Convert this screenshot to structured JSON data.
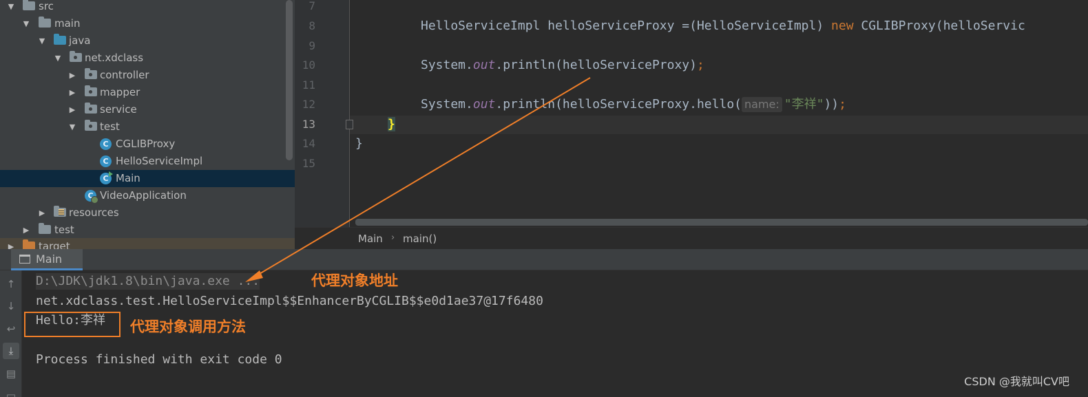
{
  "project_tree": {
    "items": [
      {
        "label": "src",
        "expanded": true
      },
      {
        "label": "main",
        "expanded": true
      },
      {
        "label": "java",
        "expanded": true
      },
      {
        "label": "net.xdclass",
        "expanded": true
      },
      {
        "label": "controller",
        "expanded": false
      },
      {
        "label": "mapper",
        "expanded": false
      },
      {
        "label": "service",
        "expanded": false
      },
      {
        "label": "test",
        "expanded": true
      },
      {
        "label": "CGLIBProxy",
        "icon_letter": "C"
      },
      {
        "label": "HelloServiceImpl",
        "icon_letter": "C"
      },
      {
        "label": "Main",
        "icon_letter": "C",
        "selected": true
      },
      {
        "label": "VideoApplication",
        "icon_letter": "C"
      },
      {
        "label": "resources",
        "expanded": false
      },
      {
        "label": "test",
        "expanded": false
      },
      {
        "label": "target",
        "expanded": false
      }
    ]
  },
  "editor": {
    "line_numbers": [
      "7",
      "8",
      "9",
      "10",
      "11",
      "12",
      "13",
      "14",
      "15"
    ],
    "current_line": "13",
    "code": {
      "line8_a": "HelloServiceImpl helloServiceProxy =(HelloServiceImpl) ",
      "line8_kw": "new",
      "line8_b": " CGLIBProxy(helloServic",
      "line10_a": "System.",
      "line10_field": "out",
      "line10_b": ".println(helloServiceProxy)",
      "line10_semi": ";",
      "line12_a": "System.",
      "line12_field": "out",
      "line12_b": ".println(helloServiceProxy.hello(",
      "line12_hint": "name:",
      "line12_str": "\"李祥\"",
      "line12_c": "))",
      "line12_semi": ";",
      "line13": "}",
      "line14": "}"
    },
    "breadcrumb": [
      "Main",
      "main()"
    ],
    "breadcrumb_separator": "›"
  },
  "run_panel": {
    "tab_label": "Main",
    "toolbar_icons": [
      "up-arrow-icon",
      "down-arrow-icon",
      "soft-wrap-icon",
      "scroll-to-end-icon",
      "print-icon",
      "trash-icon"
    ],
    "console_lines": [
      "D:\\JDK\\jdk1.8\\bin\\java.exe ...",
      "net.xdclass.test.HelloServiceImpl$$EnhancerByCGLIB$$e0d1ae37@17f6480",
      "Hello:李祥",
      "Process finished with exit code 0"
    ]
  },
  "annotations": {
    "proxy_address": "代理对象地址",
    "proxy_method_call": "代理对象调用方法",
    "color": "#f07f29"
  },
  "watermark": "CSDN @我就叫CV吧"
}
